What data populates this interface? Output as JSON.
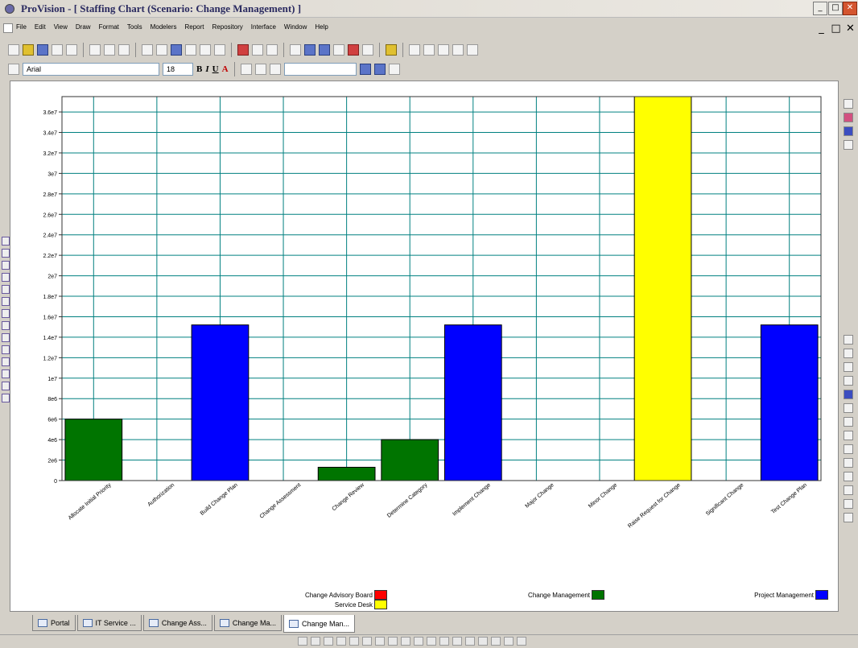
{
  "window": {
    "title": "ProVision - [ Staffing Chart (Scenario: Change Management) ]",
    "controls": [
      "_",
      "□",
      "✕"
    ]
  },
  "menu": {
    "items": [
      "File",
      "Edit",
      "View",
      "Draw",
      "Format",
      "Tools",
      "Modelers",
      "Report",
      "Repository",
      "Interface",
      "Window",
      "Help"
    ],
    "mdi_controls": [
      "_",
      "□",
      "✕"
    ]
  },
  "format_toolbar": {
    "font_name": "Arial",
    "font_size": "18",
    "bold": "B",
    "italic": "I",
    "underline": "U",
    "font_color": "A"
  },
  "chart_data": {
    "type": "bar",
    "categories": [
      "Allocate Initial Priority",
      "Authorization",
      "Build Change Plan",
      "Change Assessment",
      "Change Review",
      "Determine Category",
      "Implement Change",
      "Major Change",
      "Minor Change",
      "Raise Request for Change",
      "Significant Change",
      "Test Change Plan"
    ],
    "values": [
      6000000,
      0,
      15200000,
      0,
      1300000,
      4000000,
      15200000,
      0,
      0,
      37500000,
      0,
      15200000
    ],
    "bar_colors": [
      "#007400",
      null,
      "#0000ff",
      null,
      "#007400",
      "#007400",
      "#0000ff",
      null,
      null,
      "#ffff00",
      null,
      "#0000ff"
    ],
    "ylim": [
      0,
      37500000
    ],
    "yticks": [
      "0",
      "2e6",
      "4e6",
      "6e6",
      "8e6",
      "1e7",
      "1.2e7",
      "1.4e7",
      "1.6e7",
      "1.8e7",
      "2e7",
      "2.2e7",
      "2.4e7",
      "2.6e7",
      "2.8e7",
      "3e7",
      "3.2e7",
      "3.4e7",
      "3.6e7"
    ],
    "grid": true,
    "grid_color": "#008080",
    "legend": [
      {
        "name": "Change Advisory Board",
        "color": "#ff0000"
      },
      {
        "name": "Service Desk",
        "color": "#ffff00"
      },
      {
        "name": "Change Management",
        "color": "#007400"
      },
      {
        "name": "Project Management",
        "color": "#0000ff"
      }
    ]
  },
  "tabs": [
    "Portal",
    "IT Service ...",
    "Change Ass...",
    "Change Ma...",
    "Change Man..."
  ],
  "active_tab": "Change Man..."
}
